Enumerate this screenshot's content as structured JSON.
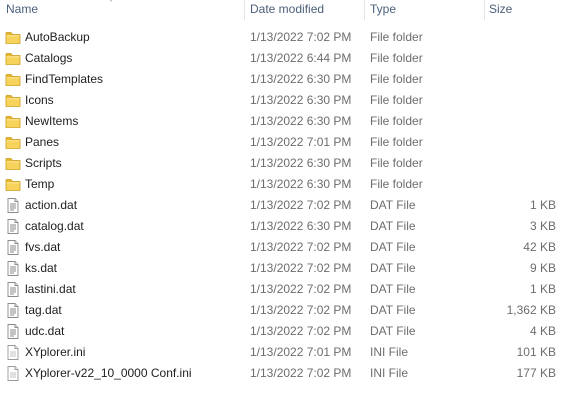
{
  "columns": {
    "name": "Name",
    "date": "Date modified",
    "type": "Type",
    "size": "Size"
  },
  "colors": {
    "header_text": "#4c607a",
    "name_text": "#1e1e1e",
    "detail_text": "#6d6d6d",
    "folder_fill": "#f5c542"
  },
  "files": [
    {
      "name": "AutoBackup",
      "date": "1/13/2022 7:02 PM",
      "type": "File folder",
      "size": "",
      "icon": "folder-icon"
    },
    {
      "name": "Catalogs",
      "date": "1/13/2022 6:44 PM",
      "type": "File folder",
      "size": "",
      "icon": "folder-icon"
    },
    {
      "name": "FindTemplates",
      "date": "1/13/2022 6:30 PM",
      "type": "File folder",
      "size": "",
      "icon": "folder-icon"
    },
    {
      "name": "Icons",
      "date": "1/13/2022 6:30 PM",
      "type": "File folder",
      "size": "",
      "icon": "folder-icon"
    },
    {
      "name": "NewItems",
      "date": "1/13/2022 6:30 PM",
      "type": "File folder",
      "size": "",
      "icon": "folder-icon"
    },
    {
      "name": "Panes",
      "date": "1/13/2022 7:01 PM",
      "type": "File folder",
      "size": "",
      "icon": "folder-icon"
    },
    {
      "name": "Scripts",
      "date": "1/13/2022 6:30 PM",
      "type": "File folder",
      "size": "",
      "icon": "folder-icon"
    },
    {
      "name": "Temp",
      "date": "1/13/2022 6:30 PM",
      "type": "File folder",
      "size": "",
      "icon": "folder-icon"
    },
    {
      "name": "action.dat",
      "date": "1/13/2022 7:02 PM",
      "type": "DAT File",
      "size": "1 KB",
      "icon": "dat-file-icon"
    },
    {
      "name": "catalog.dat",
      "date": "1/13/2022 6:30 PM",
      "type": "DAT File",
      "size": "3 KB",
      "icon": "dat-file-icon"
    },
    {
      "name": "fvs.dat",
      "date": "1/13/2022 7:02 PM",
      "type": "DAT File",
      "size": "42 KB",
      "icon": "dat-file-icon"
    },
    {
      "name": "ks.dat",
      "date": "1/13/2022 7:02 PM",
      "type": "DAT File",
      "size": "9 KB",
      "icon": "dat-file-icon"
    },
    {
      "name": "lastini.dat",
      "date": "1/13/2022 7:02 PM",
      "type": "DAT File",
      "size": "1 KB",
      "icon": "dat-file-icon"
    },
    {
      "name": "tag.dat",
      "date": "1/13/2022 7:02 PM",
      "type": "DAT File",
      "size": "1,362 KB",
      "icon": "dat-file-icon"
    },
    {
      "name": "udc.dat",
      "date": "1/13/2022 7:02 PM",
      "type": "DAT File",
      "size": "4 KB",
      "icon": "dat-file-icon"
    },
    {
      "name": "XYplorer.ini",
      "date": "1/13/2022 7:01 PM",
      "type": "INI File",
      "size": "101 KB",
      "icon": "ini-file-icon"
    },
    {
      "name": "XYplorer-v22_10_0000 Conf.ini",
      "date": "1/13/2022 7:02 PM",
      "type": "INI File",
      "size": "177 KB",
      "icon": "ini-file-icon"
    }
  ]
}
